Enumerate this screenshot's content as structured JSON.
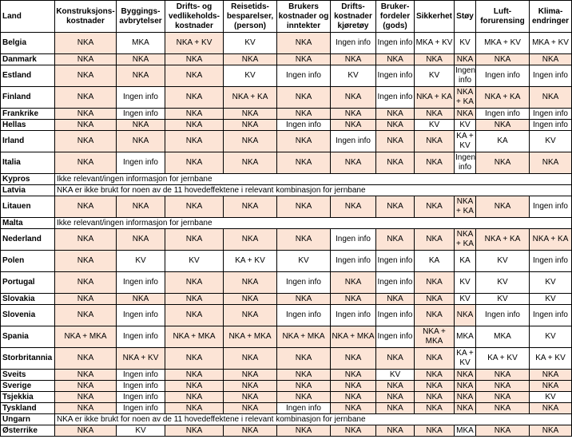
{
  "headers": [
    "Land",
    "Konstruksjons-kostnader",
    "Byggings-avbrytelser",
    "Drifts- og vedlikeholds-kostnader",
    "Reisetids-besparelser, (person)",
    "Brukers kostnader og inntekter",
    "Drifts-kostnader kjøretøy",
    "Bruker-fordeler (gods)",
    "Sikkerhet",
    "Støy",
    "Luft-forurensing",
    "Klima-endringer"
  ],
  "highlight_color": "#fce4d6",
  "rows": [
    {
      "land": "Belgia",
      "tall": true,
      "cells": [
        "NKA",
        "MKA",
        "NKA + KV",
        "KV",
        "NKA",
        "Ingen info",
        "Ingen info",
        "MKA + KV",
        "KV",
        "MKA + KV",
        "MKA + KV"
      ]
    },
    {
      "land": "Danmark",
      "cells": [
        "NKA",
        "NKA",
        "NKA",
        "NKA",
        "NKA",
        "NKA",
        "NKA",
        "NKA",
        "NKA",
        "NKA",
        "NKA"
      ]
    },
    {
      "land": "Estland",
      "tall": true,
      "cells": [
        "NKA",
        "NKA",
        "NKA",
        "KV",
        "Ingen info",
        "KV",
        "Ingen info",
        "KV",
        "Ingen info",
        "Ingen info",
        "Ingen info"
      ]
    },
    {
      "land": "Finland",
      "tall": true,
      "cells": [
        "NKA",
        "Ingen info",
        "NKA",
        "NKA + KA",
        "NKA",
        "NKA",
        "Ingen info",
        "NKA + KA",
        "NKA + KA",
        "NKA + KA",
        "NKA"
      ]
    },
    {
      "land": "Frankrike",
      "cells": [
        "NKA",
        "Ingen info",
        "NKA",
        "NKA",
        "NKA",
        "NKA",
        "NKA",
        "NKA",
        "NKA",
        "Ingen info",
        "Ingen info"
      ]
    },
    {
      "land": "Hellas",
      "cells": [
        "NKA",
        "NKA",
        "NKA",
        "NKA",
        "Ingen info",
        "NKA",
        "NKA",
        "KV",
        "KV",
        "NKA",
        "Ingen info"
      ]
    },
    {
      "land": "Irland",
      "tall": true,
      "cells": [
        "NKA",
        "NKA",
        "NKA",
        "NKA",
        "NKA",
        "Ingen info",
        "NKA",
        "NKA",
        "KA + KV",
        "KA",
        "KV"
      ]
    },
    {
      "land": "Italia",
      "tall": true,
      "cells": [
        "NKA",
        "Ingen info",
        "NKA",
        "NKA",
        "NKA",
        "NKA",
        "NKA",
        "NKA",
        "Ingen info",
        "NKA",
        "NKA"
      ]
    },
    {
      "land": "Kypros",
      "note": "Ikke relevant/ingen informasjon for jernbane"
    },
    {
      "land": "Latvia",
      "note": "NKA er ikke brukt for noen av de 11 hovedeffektene i relevant kombinasjon for jernbane"
    },
    {
      "land": "Litauen",
      "tall": true,
      "cells": [
        "NKA",
        "NKA",
        "NKA",
        "NKA",
        "NKA",
        "NKA",
        "NKA",
        "NKA",
        "NKA + KA",
        "NKA",
        "Ingen info"
      ]
    },
    {
      "land": "Malta",
      "note": "Ikke relevant/ingen informasjon for jernbane"
    },
    {
      "land": "Nederland",
      "tall": true,
      "cells": [
        "NKA",
        "NKA",
        "NKA",
        "NKA",
        "NKA",
        "Ingen info",
        "NKA",
        "NKA",
        "NKA + KA",
        "NKA + KA",
        "NKA + KA"
      ]
    },
    {
      "land": "Polen",
      "tall": true,
      "cells": [
        "NKA",
        "KV",
        "KV",
        "KA + KV",
        "KV",
        "Ingen info",
        "Ingen info",
        "KA",
        "KA",
        "KV",
        "Ingen info"
      ]
    },
    {
      "land": "Portugal",
      "tall": true,
      "cells": [
        "NKA",
        "Ingen info",
        "NKA",
        "NKA",
        "Ingen info",
        "NKA",
        "Ingen info",
        "NKA",
        "KV",
        "KV",
        "KV"
      ]
    },
    {
      "land": "Slovakia",
      "cells": [
        "NKA",
        "NKA",
        "NKA",
        "NKA",
        "NKA",
        "NKA",
        "NKA",
        "NKA",
        "KV",
        "KV",
        "KV"
      ]
    },
    {
      "land": "Slovenia",
      "tall": true,
      "cells": [
        "NKA",
        "Ingen info",
        "NKA",
        "NKA",
        "Ingen info",
        "Ingen info",
        "Ingen info",
        "NKA",
        "NKA",
        "Ingen info",
        "Ingen info"
      ]
    },
    {
      "land": "Spania",
      "tall": true,
      "cells": [
        "NKA + MKA",
        "Ingen info",
        "NKA + MKA",
        "NKA + MKA",
        "NKA + MKA",
        "NKA + MKA",
        "Ingen info",
        "NKA + MKA",
        "MKA",
        "MKA",
        "KV"
      ]
    },
    {
      "land": "Storbritannia",
      "tall": true,
      "cells": [
        "NKA",
        "NKA + KV",
        "NKA",
        "NKA",
        "NKA",
        "NKA",
        "NKA",
        "NKA",
        "KA + KV",
        "KA + KV",
        "KA + KV"
      ]
    },
    {
      "land": "Sveits",
      "cells": [
        "NKA",
        "Ingen info",
        "NKA",
        "NKA",
        "NKA",
        "NKA",
        "KV",
        "NKA",
        "NKA",
        "NKA",
        "NKA"
      ]
    },
    {
      "land": "Sverige",
      "cells": [
        "NKA",
        "Ingen info",
        "NKA",
        "NKA",
        "NKA",
        "NKA",
        "NKA",
        "NKA",
        "NKA",
        "NKA",
        "NKA"
      ]
    },
    {
      "land": "Tsjekkia",
      "cells": [
        "NKA",
        "Ingen info",
        "NKA",
        "NKA",
        "NKA",
        "NKA",
        "NKA",
        "NKA",
        "NKA",
        "NKA",
        "KV"
      ]
    },
    {
      "land": "Tyskland",
      "cells": [
        "NKA",
        "Ingen info",
        "NKA",
        "NKA",
        "Ingen info",
        "NKA",
        "NKA",
        "NKA",
        "NKA",
        "NKA",
        "NKA"
      ]
    },
    {
      "land": "Ungarn",
      "note": "NKA er ikke brukt for noen av de 11 hovedeffektene i relevant kombinasjon for jernbane"
    },
    {
      "land": "Østerrike",
      "cells": [
        "NKA",
        "KV",
        "NKA",
        "NKA",
        "NKA",
        "NKA",
        "NKA",
        "NKA",
        "MKA",
        "NKA",
        "NKA"
      ]
    }
  ]
}
